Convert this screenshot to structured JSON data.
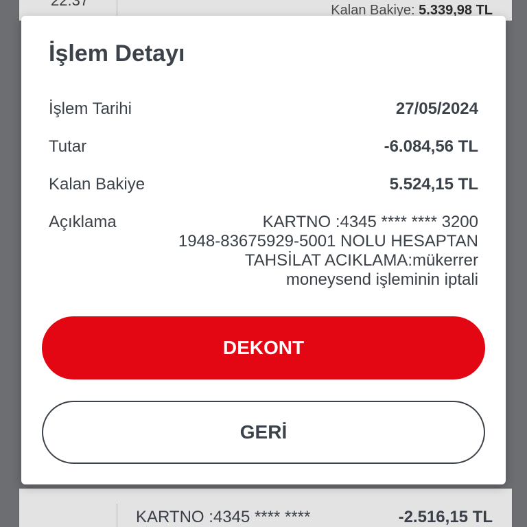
{
  "background": {
    "top_time": "22:37",
    "top_balance_label": "Kalan Bakiye:",
    "top_balance_value": "5.339,98 TL",
    "bottom_description": "KARTNO :4345 **** ****",
    "bottom_amount": "-2.516,15 TL"
  },
  "dialog": {
    "title": "İşlem Detayı",
    "rows": {
      "date": {
        "label": "İşlem Tarihi",
        "value": "27/05/2024"
      },
      "amount": {
        "label": "Tutar",
        "value": "-6.084,56 TL"
      },
      "balance": {
        "label": "Kalan Bakiye",
        "value": "5.524,15 TL"
      },
      "description": {
        "label": "Açıklama",
        "lines": [
          "KARTNO :4345 **** **** 3200",
          "1948-83675929-5001 NOLU HESAPTAN",
          "TAHSİLAT ACIKLAMA:mükerrer",
          "moneysend işleminin iptali"
        ]
      }
    },
    "buttons": {
      "primary_label": "DEKONT",
      "secondary_label": "GERİ"
    }
  },
  "colors": {
    "accent_red": "#e30613",
    "text_dark": "#3c4249",
    "overlay": "#6c6e71"
  }
}
